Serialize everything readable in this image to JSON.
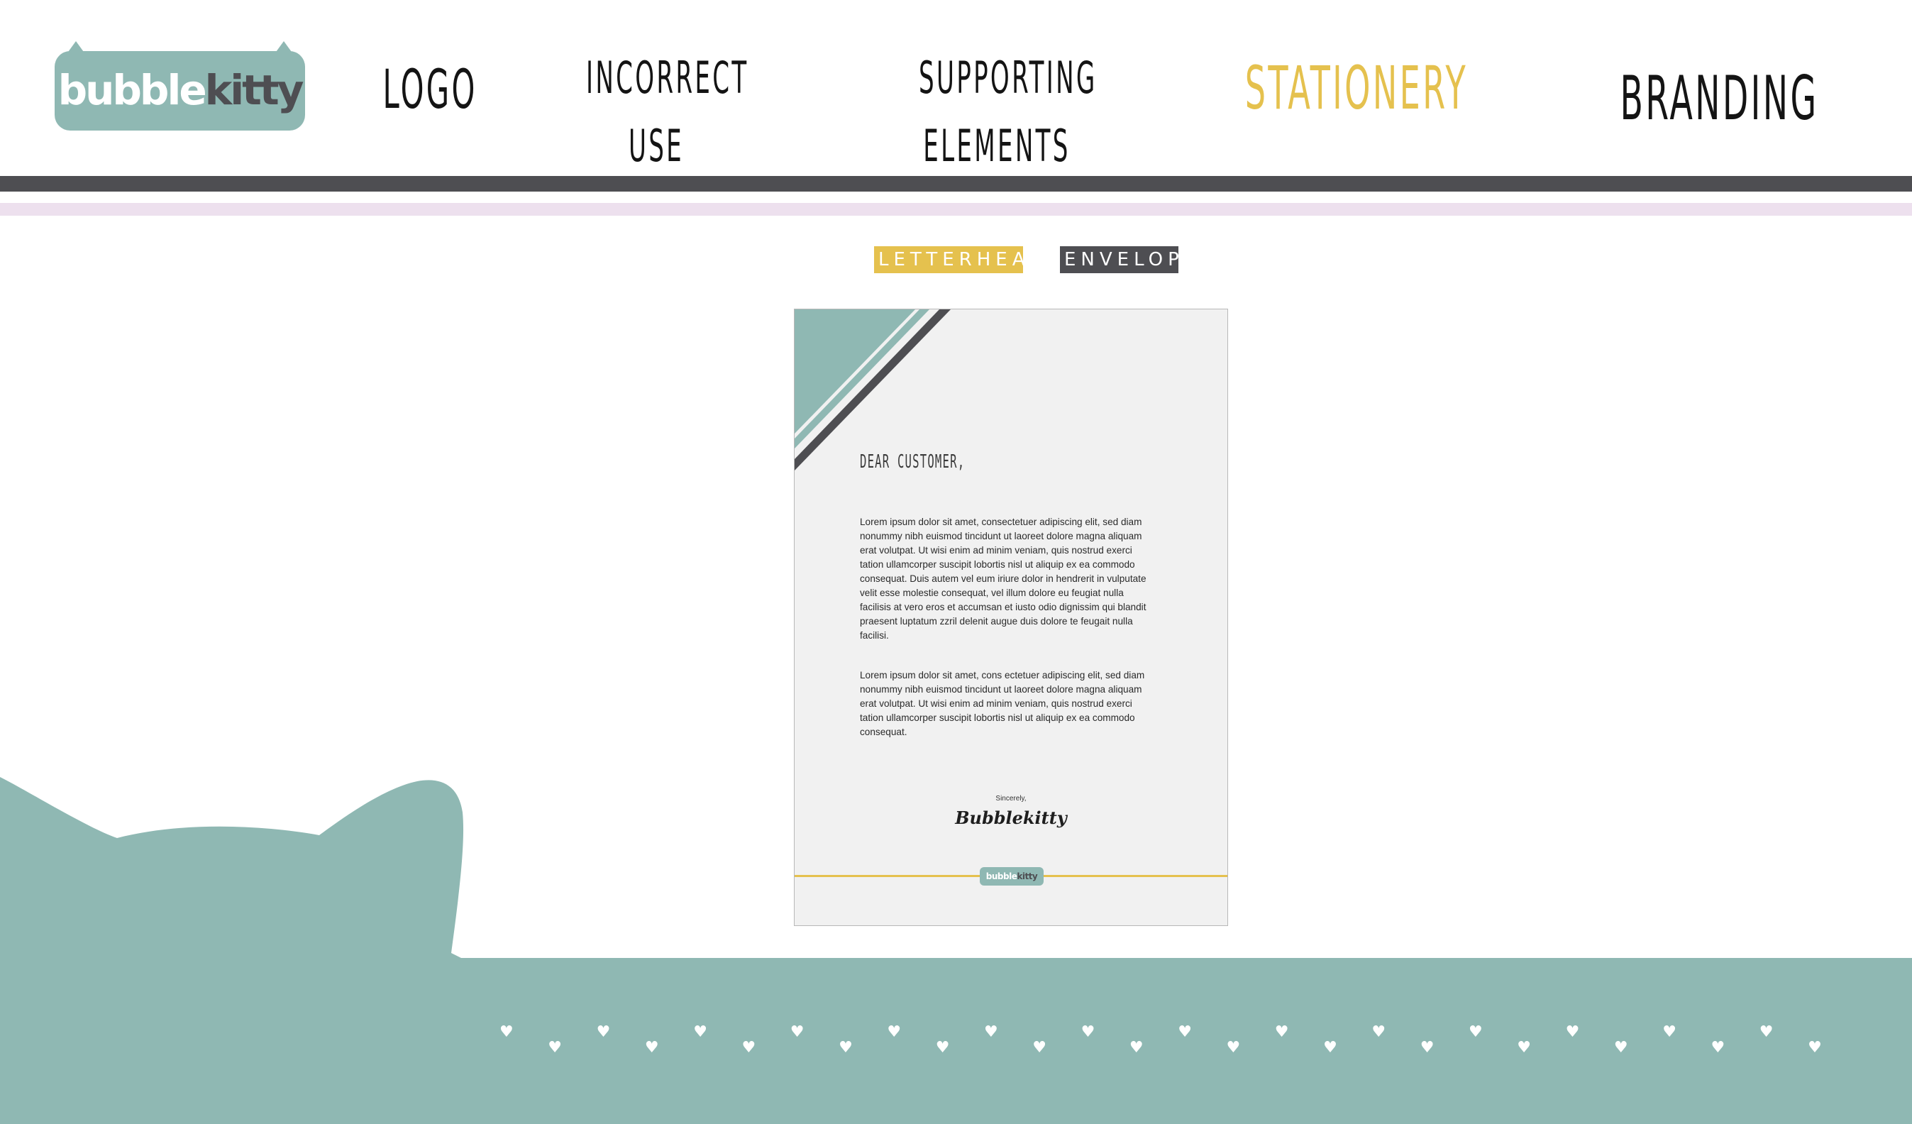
{
  "header": {
    "logo": {
      "part1": "bubble",
      "part2": "kitty"
    },
    "nav": [
      {
        "label_line1": "LOGO",
        "label_line2": ""
      },
      {
        "label_line1": "INCORRECT",
        "label_line2": "USE"
      },
      {
        "label_line1": "SUPPORTING",
        "label_line2": "ELEMENTS"
      },
      {
        "label_line1": "STATIONERY",
        "label_line2": ""
      },
      {
        "label_line1": "BRANDING",
        "label_line2": ""
      }
    ]
  },
  "subtabs": [
    {
      "label": "LETTERHEAD"
    },
    {
      "label": "ENVELOPE"
    }
  ],
  "letter": {
    "greeting": "DEAR CUSTOMER,",
    "paragraph1": "Lorem ipsum dolor sit amet, consectetuer adipiscing elit, sed diam nonummy nibh euismod tincidunt ut laoreet dolore magna aliquam erat volutpat. Ut wisi enim ad minim veniam, quis nostrud exerci tation ullamcorper suscipit lobortis nisl ut aliquip ex ea commodo consequat. Duis autem vel eum iriure dolor in hendrerit in vulputate velit esse molestie consequat, vel illum dolore eu feugiat nulla facilisis at vero eros et accumsan et iusto odio dignissim qui blandit praesent luptatum zzril delenit augue duis dolore te feugait nulla facilisi.",
    "paragraph2": "Lorem ipsum dolor sit amet, cons ectetuer adipiscing elit, sed diam nonummy nibh euismod tincidunt ut laoreet dolore magna aliquam erat volutpat. Ut wisi enim ad minim veniam, quis nostrud exerci tation ullamcorper suscipit lobortis nisl ut aliquip ex ea commodo consequat.",
    "closing": "Sincerely,",
    "signature": "Bubblekitty",
    "footer_logo": {
      "part1": "bubble",
      "part2": "kitty"
    }
  },
  "colors": {
    "teal": "#8fb8b3",
    "dark_gray": "#4e4e52",
    "yellow": "#e5c14e",
    "pink": "#ede0ee"
  },
  "icons": [
    "heart-icon",
    "cat-silhouette"
  ]
}
